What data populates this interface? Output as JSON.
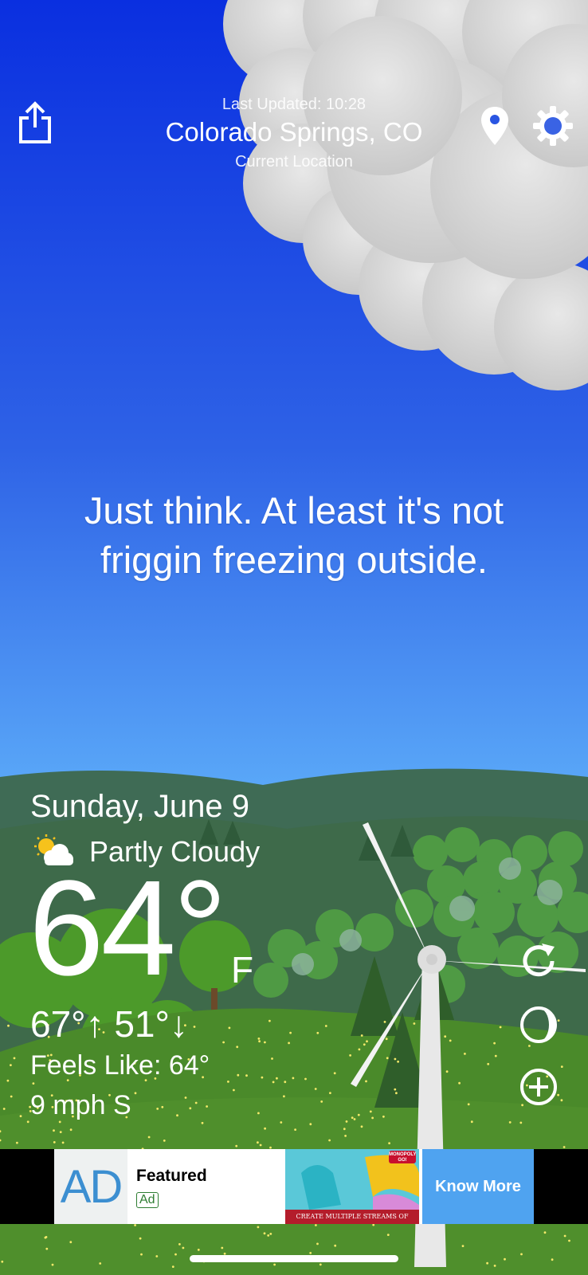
{
  "header": {
    "last_updated": "Last Updated: 10:28",
    "location_name": "Colorado Springs, CO",
    "location_sub": "Current Location"
  },
  "icons": {
    "share": "share-icon",
    "location": "map-pin-icon",
    "settings": "gear-icon",
    "refresh": "refresh-icon",
    "moon": "moon-phase-icon",
    "add": "plus-circle-icon",
    "condition": "partly-cloudy-icon"
  },
  "quote": "Just think. At least it's not friggin freezing outside.",
  "weather": {
    "date": "Sunday, June 9",
    "condition": "Partly Cloudy",
    "temperature": "64°",
    "unit": "F",
    "hi_lo": "67°↑ 51°↓",
    "feels_like": "Feels Like: 64°",
    "wind": "9 mph S"
  },
  "ad": {
    "logo_text": "AD",
    "title": "Featured",
    "badge": "Ad",
    "image_caption": "CREATE MULTIPLE STREAMS OF INCOME",
    "image_brand": "MONOPOLY GO!",
    "cta": "Know More"
  },
  "colors": {
    "sky_top": "#0a2fe0",
    "sky_bottom": "#5aa8f8",
    "grass": "#4a8a2a",
    "ad_button": "#4fa3f0"
  }
}
